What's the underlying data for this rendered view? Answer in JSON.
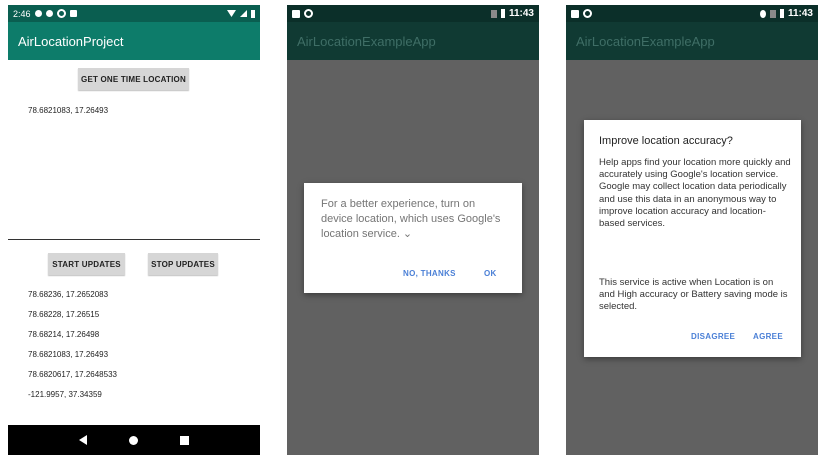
{
  "phone1": {
    "status": {
      "time": "2:46"
    },
    "app_title": "AirLocationProject",
    "one_time_button": "GET ONE TIME LOCATION",
    "one_time_result": "78.6821083, 17.26493",
    "start_button": "START UPDATES",
    "stop_button": "STOP UPDATES",
    "updates": [
      "78.68236, 17.2652083",
      "78.68228, 17.26515",
      "78.68214, 17.26498",
      "78.6821083, 17.26493",
      "78.6820617, 17.2648533",
      "-121.9957, 37.34359"
    ]
  },
  "phone2": {
    "status": {
      "time": "11:43"
    },
    "app_title": "AirLocationExampleApp",
    "dialog": {
      "message": "For a better experience, turn on device location, which uses Google's location service. ⌄",
      "negative": "NO, THANKS",
      "positive": "OK"
    }
  },
  "phone3": {
    "status": {
      "time": "11:43"
    },
    "app_title": "AirLocationExampleApp",
    "dialog": {
      "title": "Improve location accuracy?",
      "body1": "Help apps find your location more quickly and accurately using Google's location service. Google may collect location data periodically and use this data in an anonymous way to improve location accuracy and location-based services.",
      "body2": "This service is active when Location is on and High accuracy or Battery saving mode is selected.",
      "negative": "DISAGREE",
      "positive": "AGREE"
    }
  },
  "colors": {
    "teal_primary": "#0d7c6a",
    "teal_dark": "#0a5e50",
    "dim_overlay": "#616161",
    "dialog_button": "#4a7fd6"
  }
}
